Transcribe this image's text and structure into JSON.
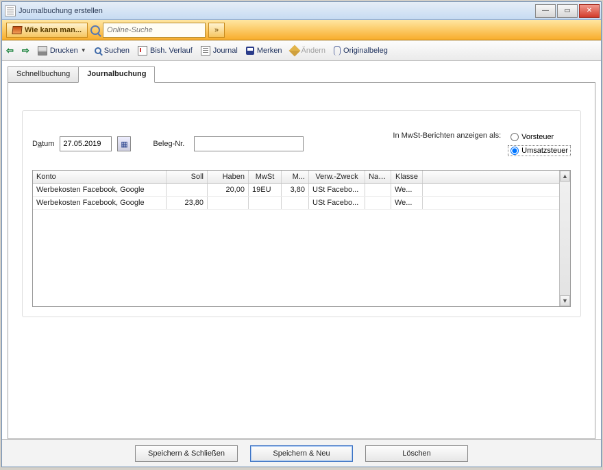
{
  "window": {
    "title": "Journalbuchung erstellen"
  },
  "help": {
    "label": "Wie kann man...",
    "search_placeholder": "Online-Suche",
    "go": "»"
  },
  "toolbar": {
    "print": "Drucken",
    "search": "Suchen",
    "history": "Bish. Verlauf",
    "journal": "Journal",
    "save": "Merken",
    "edit": "Ändern",
    "original": "Originalbeleg"
  },
  "tabs": {
    "schnell": "Schnellbuchung",
    "journal": "Journalbuchung"
  },
  "form": {
    "date_label_pre": "D",
    "date_label_mid": "a",
    "date_label_post": "tum",
    "date_value": "27.05.2019",
    "beleg_label": "Beleg-Nr.",
    "mwst_label": "In MwSt-Berichten anzeigen als:",
    "radio_vorsteuer": "Vorsteuer",
    "radio_umsatz": "Umsatzsteuer"
  },
  "grid": {
    "headers": {
      "konto": "Konto",
      "soll": "Soll",
      "haben": "Haben",
      "mwst": "MwSt",
      "m": "M...",
      "verw": "Verw.-Zweck",
      "name": "Name",
      "klasse": "Klasse"
    },
    "rows": [
      {
        "konto": "Werbekosten Facebook, Google",
        "soll": "",
        "haben": "20,00",
        "mwst": "19EU",
        "m": "3,80",
        "verw": "USt Facebo...",
        "name": "",
        "klasse": "We..."
      },
      {
        "konto": "Werbekosten Facebook, Google",
        "soll": "23,80",
        "haben": "",
        "mwst": "",
        "m": "",
        "verw": "USt Facebo...",
        "name": "",
        "klasse": "We..."
      }
    ]
  },
  "buttons": {
    "save_close": "Speichern & Schließen",
    "save_new": "Speichern & Neu",
    "delete": "Löschen"
  }
}
